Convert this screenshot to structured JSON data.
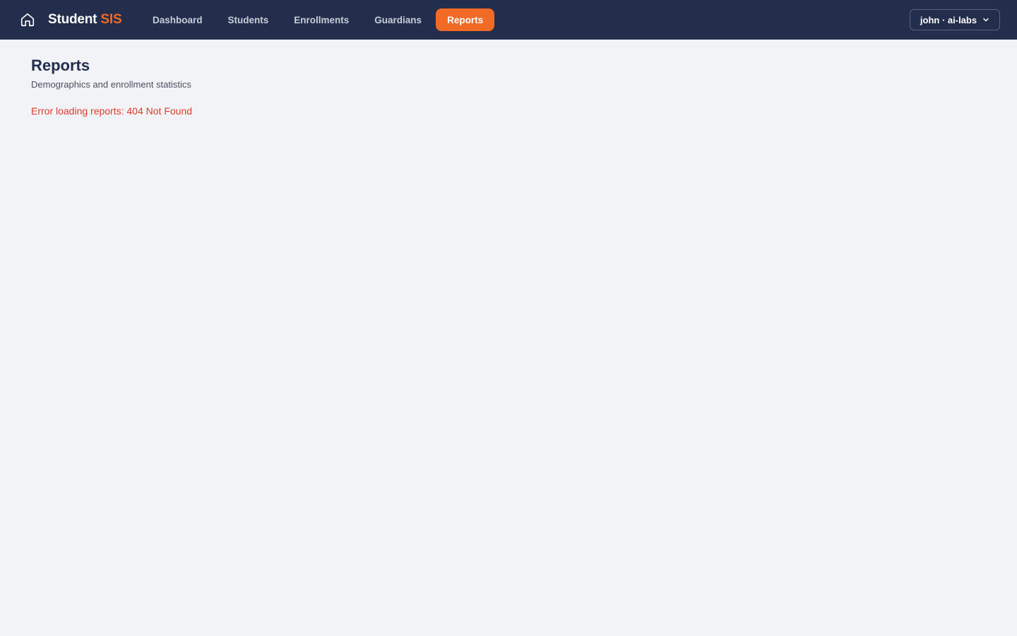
{
  "app": {
    "brand_main": "Student",
    "brand_accent": "SIS",
    "accent_color": "#f26b26",
    "header_color": "#232e4d"
  },
  "nav": {
    "items": [
      {
        "label": "Dashboard",
        "active": false
      },
      {
        "label": "Students",
        "active": false
      },
      {
        "label": "Enrollments",
        "active": false
      },
      {
        "label": "Guardians",
        "active": false
      },
      {
        "label": "Reports",
        "active": true
      }
    ]
  },
  "user": {
    "label": "john · ai-labs",
    "icon": "chevron-down-icon"
  },
  "page": {
    "title": "Reports",
    "subtitle": "Demographics and enrollment statistics",
    "error": "Error loading reports: 404 Not Found",
    "error_color": "#e03a2c"
  }
}
